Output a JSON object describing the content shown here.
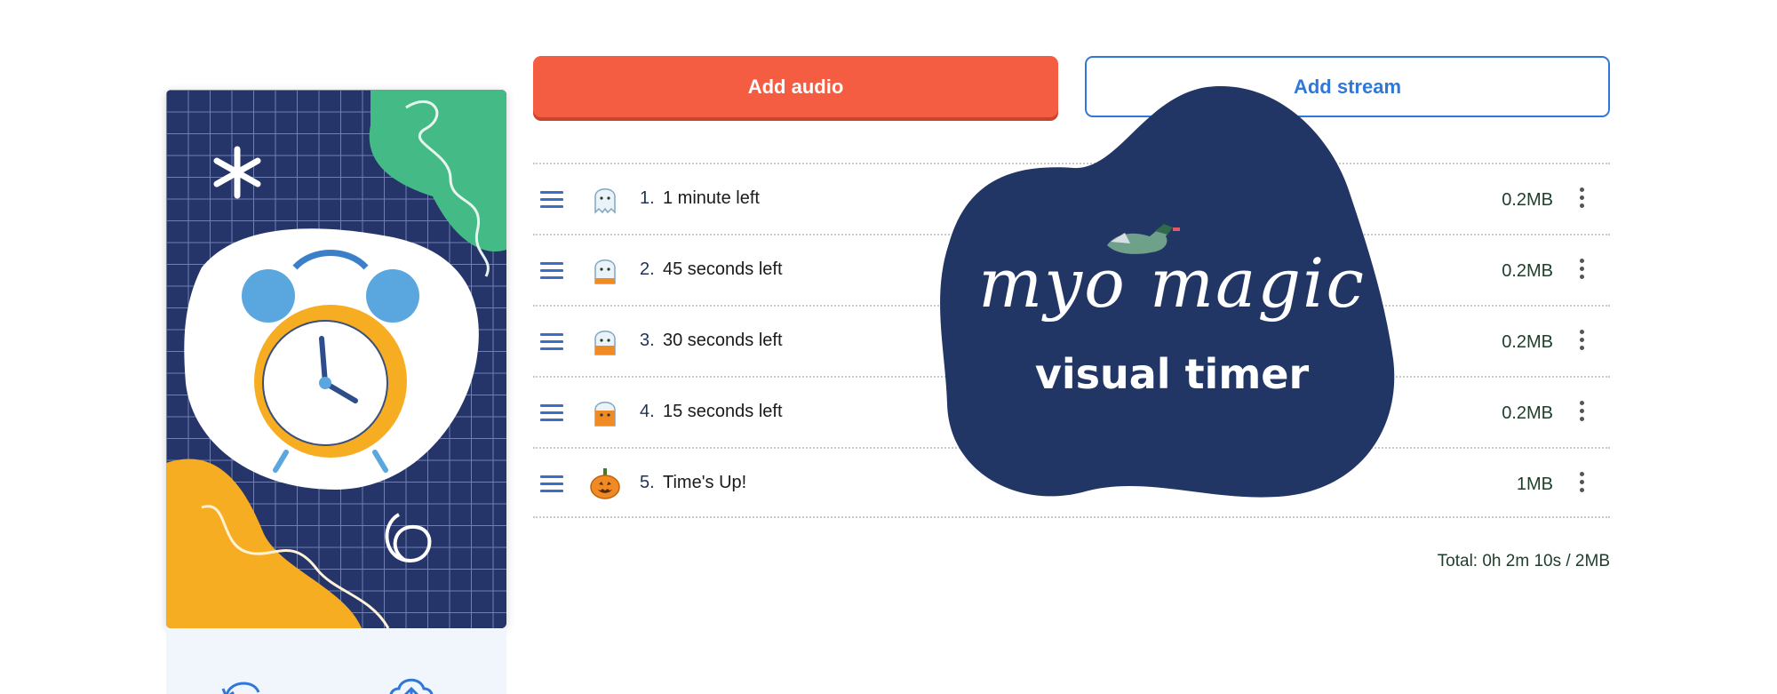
{
  "buttons": {
    "add_audio": "Add audio",
    "add_stream": "Add stream"
  },
  "tracks": [
    {
      "num": "1.",
      "title": "1 minute left",
      "size": "0.2MB",
      "icon": "ghost-icon"
    },
    {
      "num": "2.",
      "title": "45 seconds left",
      "size": "0.2MB",
      "icon": "ghost-pumpkin-icon"
    },
    {
      "num": "3.",
      "title": "30 seconds left",
      "size": "0.2MB",
      "icon": "ghost-pumpkin-icon"
    },
    {
      "num": "4.",
      "title": "15 seconds left",
      "size": "0.2MB",
      "icon": "ghost-pumpkin-icon"
    },
    {
      "num": "5.",
      "title": "Time's Up!",
      "size": "1MB",
      "icon": "pumpkin-icon"
    }
  ],
  "total": "Total: 0h 2m 10s / 2MB",
  "overlay": {
    "title": "myo magic",
    "subtitle": "visual timer"
  },
  "colors": {
    "primary": "#f55d43",
    "accent_blue": "#2f78d8",
    "cover_navy": "#25356a",
    "cover_green": "#44bb87",
    "cover_yellow": "#f6ad21"
  },
  "icons": {
    "drag": "drag-handle-icon",
    "menu": "more-vertical-icon",
    "replace_cover": "refresh-icon",
    "upload_cover": "cloud-upload-icon"
  }
}
